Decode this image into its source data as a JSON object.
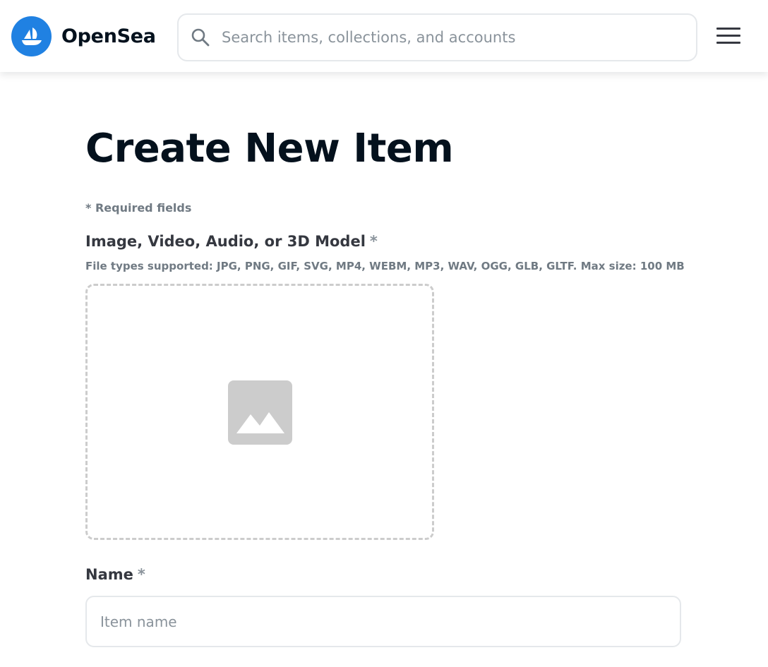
{
  "header": {
    "brand": "OpenSea",
    "search_placeholder": "Search items, collections, and accounts",
    "brand_color": "#2081e2"
  },
  "form": {
    "title": "Create New Item",
    "required_note": "* Required fields",
    "media": {
      "label": "Image, Video, Audio, or 3D Model",
      "required_mark": "*",
      "hint": "File types supported: JPG, PNG, GIF, SVG, MP4, WEBM, MP3, WAV, OGG, GLB, GLTF. Max size: 100 MB"
    },
    "name": {
      "label": "Name",
      "required_mark": "*",
      "placeholder": "Item name"
    }
  }
}
